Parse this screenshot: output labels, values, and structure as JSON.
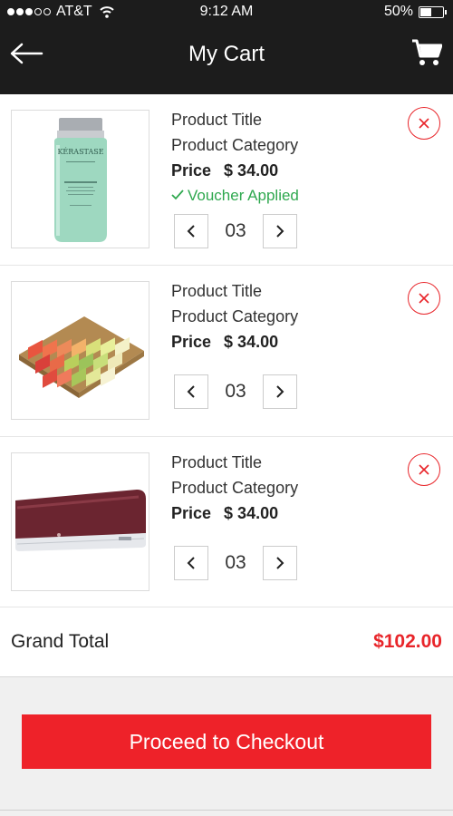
{
  "status_bar": {
    "carrier": "AT&T",
    "time": "9:12 AM",
    "battery": "50%",
    "battery_level": 0.5,
    "signal_bars": 3,
    "signal_total": 5
  },
  "header": {
    "title": "My Cart",
    "back_icon": "arrow-left-icon",
    "cart_icon": "shopping-cart-icon"
  },
  "items": [
    {
      "title": "Product Title",
      "category": "Product Category",
      "price_label": "Price",
      "price": "$ 34.00",
      "voucher": "Voucher Applied",
      "quantity": "03",
      "image": "shampoo-bottle",
      "product_brand": "KÉRASTASE"
    },
    {
      "title": "Product Title",
      "category": "Product Category",
      "price_label": "Price",
      "price": "$ 34.00",
      "quantity": "03",
      "image": "soap-bars-tray"
    },
    {
      "title": "Product Title",
      "category": "Product Category",
      "price_label": "Price",
      "price": "$ 34.00",
      "quantity": "03",
      "image": "air-conditioner"
    }
  ],
  "grand_total": {
    "label": "Grand Total",
    "value": "$102.00"
  },
  "checkout": {
    "label": "Proceed to Checkout"
  },
  "colors": {
    "accent": "#ee2229",
    "header_bg": "#1c1c1c",
    "voucher_green": "#2fa84f"
  }
}
